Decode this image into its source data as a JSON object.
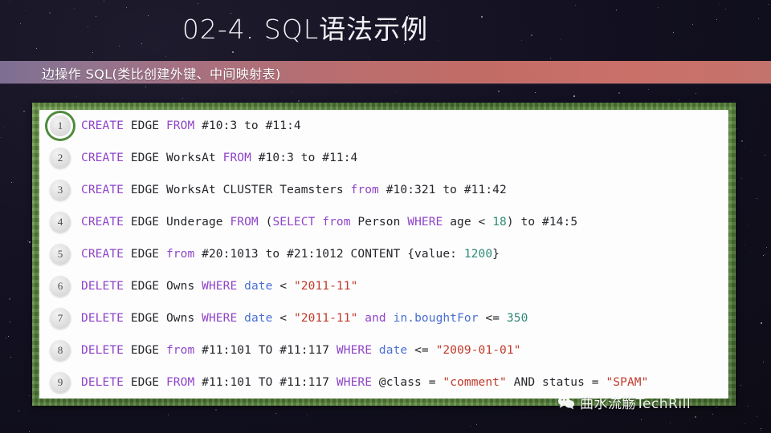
{
  "slide": {
    "title": "02-4. SQL语法示例",
    "subtitle": "边操作 SQL(类比创建外键、中间映射表)",
    "accent_green": "#4e7c34",
    "bar_gradient_start": "#7d6e92",
    "bar_gradient_end": "#c4736c",
    "background": "#121020"
  },
  "code": {
    "language": "sql",
    "active_line": 1,
    "lines": [
      {
        "number": "1",
        "tokens": [
          {
            "t": "CREATE",
            "c": "kw"
          },
          {
            "t": " EDGE ",
            "c": ""
          },
          {
            "t": "FROM",
            "c": "kw"
          },
          {
            "t": " #10:3 to #11:4",
            "c": ""
          }
        ]
      },
      {
        "number": "2",
        "tokens": [
          {
            "t": "CREATE",
            "c": "kw"
          },
          {
            "t": " EDGE WorksAt ",
            "c": ""
          },
          {
            "t": "FROM",
            "c": "kw"
          },
          {
            "t": " #10:3 to #11:4",
            "c": ""
          }
        ]
      },
      {
        "number": "3",
        "tokens": [
          {
            "t": "CREATE",
            "c": "kw"
          },
          {
            "t": " EDGE WorksAt CLUSTER Teamsters ",
            "c": ""
          },
          {
            "t": "from",
            "c": "kw"
          },
          {
            "t": " #10:321 to #11:42",
            "c": ""
          }
        ]
      },
      {
        "number": "4",
        "tokens": [
          {
            "t": "CREATE",
            "c": "kw"
          },
          {
            "t": " EDGE Underage ",
            "c": ""
          },
          {
            "t": "FROM",
            "c": "kw"
          },
          {
            "t": " (",
            "c": ""
          },
          {
            "t": "SELECT",
            "c": "kw"
          },
          {
            "t": " ",
            "c": ""
          },
          {
            "t": "from",
            "c": "kw"
          },
          {
            "t": " Person ",
            "c": ""
          },
          {
            "t": "WHERE",
            "c": "kw"
          },
          {
            "t": " age < ",
            "c": ""
          },
          {
            "t": "18",
            "c": "num"
          },
          {
            "t": ") to #14:5",
            "c": ""
          }
        ]
      },
      {
        "number": "5",
        "tokens": [
          {
            "t": "CREATE",
            "c": "kw"
          },
          {
            "t": " EDGE ",
            "c": ""
          },
          {
            "t": "from",
            "c": "kw"
          },
          {
            "t": " #20:1013 to #21:1012 CONTENT {value: ",
            "c": ""
          },
          {
            "t": "1200",
            "c": "num"
          },
          {
            "t": "}",
            "c": ""
          }
        ]
      },
      {
        "number": "6",
        "tokens": [
          {
            "t": "DELETE",
            "c": "kw"
          },
          {
            "t": " EDGE Owns ",
            "c": ""
          },
          {
            "t": "WHERE",
            "c": "kw"
          },
          {
            "t": " ",
            "c": ""
          },
          {
            "t": "date",
            "c": "fld"
          },
          {
            "t": " < ",
            "c": ""
          },
          {
            "t": "\"2011-11\"",
            "c": "str"
          }
        ]
      },
      {
        "number": "7",
        "tokens": [
          {
            "t": "DELETE",
            "c": "kw"
          },
          {
            "t": " EDGE Owns ",
            "c": ""
          },
          {
            "t": "WHERE",
            "c": "kw"
          },
          {
            "t": " ",
            "c": ""
          },
          {
            "t": "date",
            "c": "fld"
          },
          {
            "t": " < ",
            "c": ""
          },
          {
            "t": "\"2011-11\"",
            "c": "str"
          },
          {
            "t": " ",
            "c": ""
          },
          {
            "t": "and",
            "c": "kw"
          },
          {
            "t": " ",
            "c": ""
          },
          {
            "t": "in.boughtFor",
            "c": "fld"
          },
          {
            "t": " <= ",
            "c": ""
          },
          {
            "t": "350",
            "c": "num"
          }
        ]
      },
      {
        "number": "8",
        "tokens": [
          {
            "t": "DELETE",
            "c": "kw"
          },
          {
            "t": " EDGE ",
            "c": ""
          },
          {
            "t": "from",
            "c": "kw"
          },
          {
            "t": " #11:101 TO #11:117 ",
            "c": ""
          },
          {
            "t": "WHERE",
            "c": "kw"
          },
          {
            "t": " ",
            "c": ""
          },
          {
            "t": "date",
            "c": "fld"
          },
          {
            "t": " <= ",
            "c": ""
          },
          {
            "t": "\"2009-01-01\"",
            "c": "str"
          }
        ]
      },
      {
        "number": "9",
        "tokens": [
          {
            "t": "DELETE",
            "c": "kw"
          },
          {
            "t": " EDGE ",
            "c": ""
          },
          {
            "t": "FROM",
            "c": "kw"
          },
          {
            "t": " #11:101 TO #11:117 ",
            "c": ""
          },
          {
            "t": "WHERE",
            "c": "kw"
          },
          {
            "t": " @class = ",
            "c": ""
          },
          {
            "t": "\"comment\"",
            "c": "str"
          },
          {
            "t": " AND status = ",
            "c": ""
          },
          {
            "t": "\"SPAM\"",
            "c": "str"
          }
        ]
      }
    ]
  },
  "watermark": {
    "icon": "wechat-icon",
    "text": "曲水流觞TechRill"
  }
}
